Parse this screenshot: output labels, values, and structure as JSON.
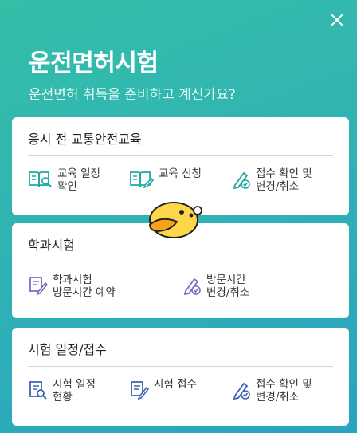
{
  "header": {
    "title": "운전면허시험",
    "subtitle": "운전면허 취득을 준비하고 계신가요?"
  },
  "sections": [
    {
      "title": "응시 전 교통안전교육",
      "items": [
        {
          "label": "교육 일정\n확인",
          "icon": "book-search-icon"
        },
        {
          "label": "교육 신청",
          "icon": "book-pen-icon"
        },
        {
          "label": "접수 확인 및\n변경/취소",
          "icon": "pen-check-icon"
        }
      ]
    },
    {
      "title": "학과시험",
      "items": [
        {
          "label": "학과시험\n방문시간 예약",
          "icon": "doc-pen-icon"
        },
        {
          "label": "방문시간\n변경/취소",
          "icon": "pen-check-icon"
        }
      ]
    },
    {
      "title": "시험 일정/접수",
      "items": [
        {
          "label": "시험 일정\n현황",
          "icon": "doc-search-icon"
        },
        {
          "label": "시험 접수",
          "icon": "doc-pen-icon"
        },
        {
          "label": "접수 확인 및\n변경/취소",
          "icon": "pen-check-icon"
        }
      ]
    }
  ],
  "colors": {
    "bg_top": "#34bfa8",
    "bg_bottom": "#2aa3bf",
    "icon_teal": "#1fa9a3",
    "icon_purple": "#7a6cc4",
    "icon_blue": "#3f63b8"
  },
  "icons": {
    "close": "close-icon",
    "mascot": "duck-mascot-icon"
  }
}
